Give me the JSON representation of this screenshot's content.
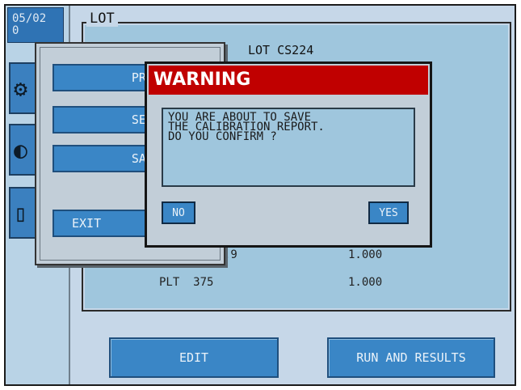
{
  "sidebar": {
    "date_lines": [
      "05/02",
      "0"
    ],
    "tab_icons": [
      "gear-icon",
      "vial-icon",
      "document-icon"
    ]
  },
  "lot_group": {
    "title": "LOT",
    "lot_number": "LOT CS224",
    "rows": [
      {
        "label": ".9",
        "value": "1.000"
      },
      {
        "label": "PLT  375",
        "value": "1.000"
      }
    ]
  },
  "menu_dialog": {
    "buttons": [
      "PRIN",
      "SENI",
      "SAVI",
      "EXIT"
    ]
  },
  "warning": {
    "title": "WARNING",
    "message": "YOU ARE ABOUT TO SAVE\nTHE CALIBRATION REPORT.\nDO YOU CONFIRM ?",
    "no_label": "NO",
    "yes_label": "YES"
  },
  "bottom_buttons": {
    "edit": "EDIT",
    "run_results": "RUN AND RESULTS"
  }
}
